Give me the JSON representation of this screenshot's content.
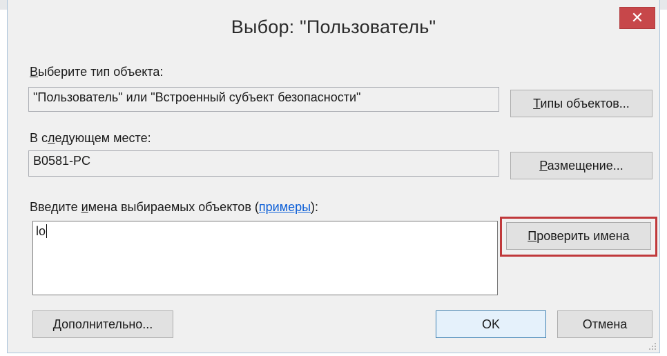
{
  "dialog": {
    "title": "Выбор: \"Пользователь\"",
    "close_label": "✕"
  },
  "object_type": {
    "label_accel": "В",
    "label_rest": "ыберите тип объекта:",
    "value": "\"Пользователь\" или \"Встроенный субъект безопасности\"",
    "button_accel": "Т",
    "button_rest": "ипы объектов..."
  },
  "location": {
    "label_pre": "В с",
    "label_accel": "л",
    "label_rest": "едующем месте:",
    "value": "B0581-PC",
    "button_accel": "Р",
    "button_rest": "азмещение..."
  },
  "names": {
    "label_pre": "Введите ",
    "label_accel": "и",
    "label_mid": "мена выбираемых объектов (",
    "link_text": "примеры",
    "label_post": "):",
    "input_value": "lo",
    "check_button_accel": "П",
    "check_button_rest": "роверить имена"
  },
  "footer": {
    "advanced_accel": "Д",
    "advanced_rest": "ополнительно...",
    "ok_label": "OK",
    "cancel_label": "Отмена"
  },
  "colors": {
    "close_button": "#c7474a",
    "highlight_border": "#c0393b",
    "link": "#0b5ed7"
  }
}
